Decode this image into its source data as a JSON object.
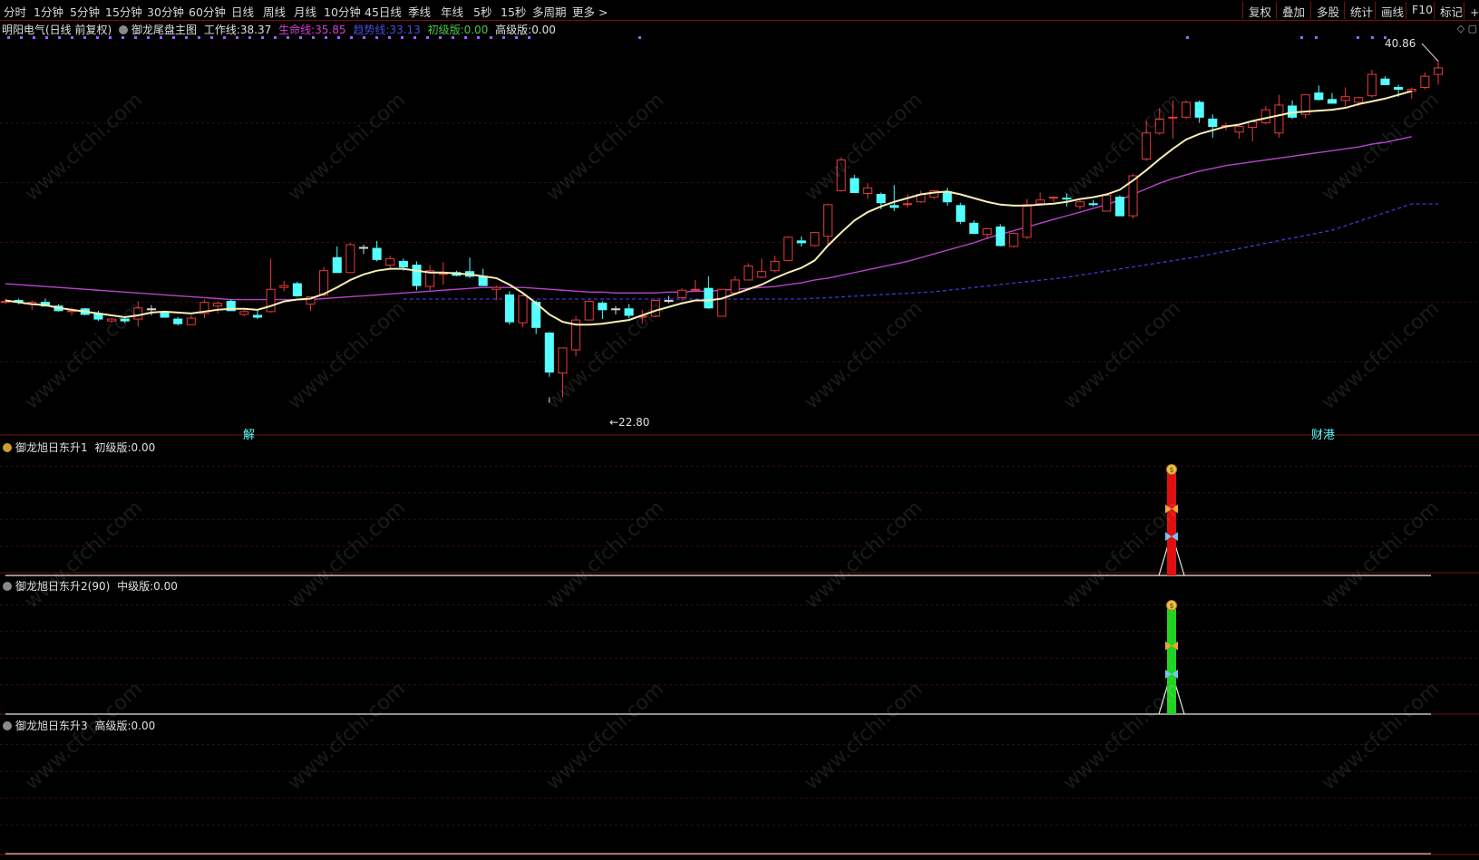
{
  "toolbar": {
    "left": [
      "分时",
      "1分钟",
      "5分钟",
      "15分钟",
      "30分钟",
      "60分钟",
      "日线",
      "周线",
      "月线",
      "10分钟",
      "45日线",
      "季线",
      "年线",
      "5秒",
      "15秒",
      "多周期",
      "更多 >"
    ],
    "right": [
      "复权",
      "叠加",
      "多股",
      "统计",
      "画线",
      "F10",
      "标记",
      "+自"
    ]
  },
  "main_header": {
    "stock": "明阳电气(日线 前复权)",
    "indicator": "御龙尾盘主图",
    "work_line_label": "工作线:",
    "work_line_value": "38.37",
    "life_line_label": "生命线:",
    "life_line_value": "35.85",
    "trend_line_label": "趋势线:",
    "trend_line_value": "33.13",
    "basic_label": "初级版:",
    "basic_value": "0.00",
    "advanced_label": "高级版:",
    "advanced_value": "0.00"
  },
  "annotations": {
    "high_label": "40.86",
    "low_label": "←22.80",
    "jie_label": "解",
    "caigang_label": "财港"
  },
  "panel1": {
    "title": "御龙旭日东升1",
    "label": "初级版:",
    "value": "0.00"
  },
  "panel2": {
    "title": "御龙旭日东升2(90)",
    "label": "中级版:",
    "value": "0.00"
  },
  "panel3": {
    "title": "御龙旭日东升3",
    "label": "高级版:",
    "value": "0.00"
  },
  "watermark": "www.cfchi.com",
  "colors": {
    "up": "#e83b3b",
    "down": "#54ffff",
    "flat": "#d8d8d8",
    "work_line": "#f7efb2",
    "life_line": "#b445c8",
    "trend_line": "#3b3bd6",
    "panel_border": "#7a1010",
    "signal_red": "#e01010",
    "signal_green": "#22d322"
  },
  "chart_data": {
    "type": "candlestick",
    "ylim": [
      21.5,
      42.2
    ],
    "candles": [
      {
        "o": 27.9,
        "h": 28.1,
        "l": 27.8,
        "c": 27.95
      },
      {
        "o": 28.0,
        "h": 28.1,
        "l": 27.8,
        "c": 27.9
      },
      {
        "o": 27.8,
        "h": 28.0,
        "l": 27.5,
        "c": 27.9
      },
      {
        "o": 27.9,
        "h": 28.1,
        "l": 27.7,
        "c": 27.7
      },
      {
        "o": 27.7,
        "h": 27.8,
        "l": 27.4,
        "c": 27.45
      },
      {
        "o": 27.4,
        "h": 27.6,
        "l": 27.2,
        "c": 27.45
      },
      {
        "o": 27.55,
        "h": 27.6,
        "l": 27.2,
        "c": 27.25
      },
      {
        "o": 27.3,
        "h": 27.45,
        "l": 26.9,
        "c": 27.0
      },
      {
        "o": 26.9,
        "h": 27.05,
        "l": 26.8,
        "c": 27.0
      },
      {
        "o": 27.0,
        "h": 27.1,
        "l": 26.8,
        "c": 26.9
      },
      {
        "o": 27.0,
        "h": 27.95,
        "l": 26.6,
        "c": 27.6
      },
      {
        "o": 27.55,
        "h": 27.75,
        "l": 27.2,
        "c": 27.55
      },
      {
        "o": 27.35,
        "h": 27.4,
        "l": 27.1,
        "c": 27.1
      },
      {
        "o": 27.0,
        "h": 27.1,
        "l": 26.65,
        "c": 26.75
      },
      {
        "o": 26.7,
        "h": 27.2,
        "l": 26.7,
        "c": 27.05
      },
      {
        "o": 27.3,
        "h": 28.05,
        "l": 27.05,
        "c": 27.9
      },
      {
        "o": 27.7,
        "h": 27.95,
        "l": 27.3,
        "c": 27.85
      },
      {
        "o": 27.95,
        "h": 28.05,
        "l": 27.45,
        "c": 27.45
      },
      {
        "o": 27.25,
        "h": 27.5,
        "l": 27.15,
        "c": 27.4
      },
      {
        "o": 27.2,
        "h": 27.45,
        "l": 27.0,
        "c": 27.1
      },
      {
        "o": 27.4,
        "h": 30.25,
        "l": 27.35,
        "c": 28.6
      },
      {
        "o": 28.7,
        "h": 29.05,
        "l": 28.5,
        "c": 28.8
      },
      {
        "o": 28.9,
        "h": 29.0,
        "l": 28.2,
        "c": 28.25
      },
      {
        "o": 27.8,
        "h": 28.2,
        "l": 27.45,
        "c": 28.2
      },
      {
        "o": 28.3,
        "h": 29.8,
        "l": 28.2,
        "c": 29.6
      },
      {
        "o": 30.3,
        "h": 30.9,
        "l": 29.9,
        "c": 29.5
      },
      {
        "o": 29.5,
        "h": 31.1,
        "l": 29.5,
        "c": 31.0
      },
      {
        "o": 30.85,
        "h": 31.0,
        "l": 30.5,
        "c": 30.85
      },
      {
        "o": 30.8,
        "h": 31.2,
        "l": 30.1,
        "c": 30.2
      },
      {
        "o": 29.9,
        "h": 30.4,
        "l": 29.7,
        "c": 30.25
      },
      {
        "o": 30.1,
        "h": 30.25,
        "l": 29.6,
        "c": 29.8
      },
      {
        "o": 29.9,
        "h": 30.1,
        "l": 28.55,
        "c": 28.8
      },
      {
        "o": 28.75,
        "h": 29.9,
        "l": 28.55,
        "c": 29.6
      },
      {
        "o": 29.4,
        "h": 30.05,
        "l": 28.85,
        "c": 29.45
      },
      {
        "o": 29.5,
        "h": 29.6,
        "l": 29.3,
        "c": 29.35
      },
      {
        "o": 29.55,
        "h": 30.3,
        "l": 29.2,
        "c": 29.3
      },
      {
        "o": 29.3,
        "h": 29.7,
        "l": 28.8,
        "c": 28.8
      },
      {
        "o": 28.6,
        "h": 28.8,
        "l": 28.0,
        "c": 28.7
      },
      {
        "o": 28.3,
        "h": 28.5,
        "l": 26.7,
        "c": 26.85
      },
      {
        "o": 26.8,
        "h": 28.4,
        "l": 26.55,
        "c": 28.25
      },
      {
        "o": 27.9,
        "h": 28.0,
        "l": 26.2,
        "c": 26.55
      },
      {
        "o": 26.25,
        "h": 26.3,
        "l": 23.9,
        "c": 24.15
      },
      {
        "o": 24.1,
        "h": 25.4,
        "l": 22.8,
        "c": 25.45
      },
      {
        "o": 25.35,
        "h": 27.15,
        "l": 25.0,
        "c": 26.95
      },
      {
        "o": 26.95,
        "h": 28.0,
        "l": 26.95,
        "c": 27.95
      },
      {
        "o": 27.85,
        "h": 27.95,
        "l": 27.0,
        "c": 27.5
      },
      {
        "o": 27.55,
        "h": 27.7,
        "l": 27.25,
        "c": 27.55
      },
      {
        "o": 27.55,
        "h": 27.8,
        "l": 27.05,
        "c": 27.2
      },
      {
        "o": 27.1,
        "h": 27.5,
        "l": 26.75,
        "c": 27.15
      },
      {
        "o": 27.15,
        "h": 28.05,
        "l": 27.1,
        "c": 28.0
      },
      {
        "o": 28.0,
        "h": 28.25,
        "l": 27.85,
        "c": 28.0
      },
      {
        "o": 28.15,
        "h": 28.65,
        "l": 28.0,
        "c": 28.55
      },
      {
        "o": 28.55,
        "h": 29.1,
        "l": 28.5,
        "c": 28.6
      },
      {
        "o": 28.65,
        "h": 29.3,
        "l": 27.55,
        "c": 27.6
      },
      {
        "o": 27.15,
        "h": 28.6,
        "l": 27.15,
        "c": 28.6
      },
      {
        "o": 28.4,
        "h": 29.3,
        "l": 28.4,
        "c": 29.1
      },
      {
        "o": 29.1,
        "h": 30.0,
        "l": 29.1,
        "c": 29.85
      },
      {
        "o": 29.25,
        "h": 30.25,
        "l": 29.2,
        "c": 29.55
      },
      {
        "o": 29.6,
        "h": 30.4,
        "l": 29.5,
        "c": 30.1
      },
      {
        "o": 30.15,
        "h": 31.45,
        "l": 30.1,
        "c": 31.4
      },
      {
        "o": 31.2,
        "h": 31.45,
        "l": 30.9,
        "c": 31.1
      },
      {
        "o": 30.95,
        "h": 31.65,
        "l": 30.9,
        "c": 31.65
      },
      {
        "o": 31.45,
        "h": 33.2,
        "l": 31.0,
        "c": 33.15
      },
      {
        "o": 33.9,
        "h": 35.7,
        "l": 33.85,
        "c": 35.55
      },
      {
        "o": 34.55,
        "h": 34.75,
        "l": 33.8,
        "c": 33.8
      },
      {
        "o": 33.75,
        "h": 34.3,
        "l": 33.45,
        "c": 34.05
      },
      {
        "o": 33.7,
        "h": 33.8,
        "l": 32.9,
        "c": 33.25
      },
      {
        "o": 33.1,
        "h": 34.2,
        "l": 32.8,
        "c": 33.0
      },
      {
        "o": 33.15,
        "h": 33.7,
        "l": 33.0,
        "c": 33.2
      },
      {
        "o": 33.3,
        "h": 33.9,
        "l": 33.25,
        "c": 33.7
      },
      {
        "o": 33.55,
        "h": 33.9,
        "l": 33.45,
        "c": 33.9
      },
      {
        "o": 33.85,
        "h": 34.05,
        "l": 33.1,
        "c": 33.3
      },
      {
        "o": 33.1,
        "h": 33.25,
        "l": 32.1,
        "c": 32.25
      },
      {
        "o": 32.15,
        "h": 32.3,
        "l": 31.6,
        "c": 31.6
      },
      {
        "o": 31.55,
        "h": 31.8,
        "l": 31.3,
        "c": 31.85
      },
      {
        "o": 31.95,
        "h": 32.1,
        "l": 30.9,
        "c": 30.95
      },
      {
        "o": 30.9,
        "h": 31.65,
        "l": 30.85,
        "c": 31.6
      },
      {
        "o": 31.4,
        "h": 33.45,
        "l": 31.3,
        "c": 33.15
      },
      {
        "o": 33.2,
        "h": 33.8,
        "l": 33.1,
        "c": 33.4
      },
      {
        "o": 33.5,
        "h": 33.6,
        "l": 33.3,
        "c": 33.55
      },
      {
        "o": 33.5,
        "h": 33.75,
        "l": 33.05,
        "c": 33.45
      },
      {
        "o": 33.05,
        "h": 33.4,
        "l": 32.9,
        "c": 33.3
      },
      {
        "o": 33.2,
        "h": 33.4,
        "l": 33.05,
        "c": 33.15
      },
      {
        "o": 32.8,
        "h": 33.65,
        "l": 32.8,
        "c": 33.65
      },
      {
        "o": 33.55,
        "h": 33.65,
        "l": 32.55,
        "c": 32.55
      },
      {
        "o": 32.55,
        "h": 34.8,
        "l": 32.4,
        "c": 34.7
      },
      {
        "o": 35.6,
        "h": 37.65,
        "l": 35.5,
        "c": 37.0
      },
      {
        "o": 37.0,
        "h": 38.35,
        "l": 36.9,
        "c": 37.75
      },
      {
        "o": 37.8,
        "h": 38.75,
        "l": 36.7,
        "c": 37.85
      },
      {
        "o": 37.85,
        "h": 38.75,
        "l": 37.75,
        "c": 38.65
      },
      {
        "o": 38.65,
        "h": 38.75,
        "l": 37.55,
        "c": 37.85
      },
      {
        "o": 37.75,
        "h": 38.0,
        "l": 36.75,
        "c": 37.35
      },
      {
        "o": 37.35,
        "h": 37.55,
        "l": 37.15,
        "c": 37.4
      },
      {
        "o": 37.05,
        "h": 37.35,
        "l": 36.7,
        "c": 37.35
      },
      {
        "o": 37.3,
        "h": 37.6,
        "l": 36.55,
        "c": 37.6
      },
      {
        "o": 37.55,
        "h": 38.45,
        "l": 37.45,
        "c": 38.25
      },
      {
        "o": 37.0,
        "h": 39.05,
        "l": 36.75,
        "c": 38.5
      },
      {
        "o": 38.45,
        "h": 38.75,
        "l": 37.75,
        "c": 37.85
      },
      {
        "o": 38.0,
        "h": 38.85,
        "l": 37.8,
        "c": 39.05
      },
      {
        "o": 39.15,
        "h": 39.55,
        "l": 38.75,
        "c": 38.8
      },
      {
        "o": 38.8,
        "h": 39.15,
        "l": 38.6,
        "c": 38.6
      },
      {
        "o": 38.75,
        "h": 39.45,
        "l": 38.45,
        "c": 38.95
      },
      {
        "o": 38.65,
        "h": 38.95,
        "l": 38.45,
        "c": 38.9
      },
      {
        "o": 39.0,
        "h": 40.4,
        "l": 38.9,
        "c": 40.15
      },
      {
        "o": 39.9,
        "h": 40.05,
        "l": 39.6,
        "c": 39.6
      },
      {
        "o": 39.45,
        "h": 39.6,
        "l": 38.95,
        "c": 39.35
      },
      {
        "o": 39.25,
        "h": 39.45,
        "l": 38.85,
        "c": 39.35
      },
      {
        "o": 39.45,
        "h": 40.25,
        "l": 39.35,
        "c": 40.05
      },
      {
        "o": 40.15,
        "h": 40.9,
        "l": 39.6,
        "c": 40.5
      }
    ],
    "work_line": [
      28.0,
      27.9,
      27.8,
      27.75,
      27.6,
      27.5,
      27.4,
      27.3,
      27.2,
      27.1,
      27.2,
      27.35,
      27.4,
      27.35,
      27.3,
      27.4,
      27.5,
      27.55,
      27.55,
      27.5,
      27.7,
      27.95,
      28.05,
      28.1,
      28.35,
      28.7,
      29.1,
      29.4,
      29.6,
      29.7,
      29.7,
      29.6,
      29.5,
      29.5,
      29.45,
      29.4,
      29.3,
      29.2,
      28.85,
      28.4,
      27.85,
      27.25,
      26.85,
      26.7,
      26.7,
      26.75,
      26.85,
      26.95,
      27.2,
      27.45,
      27.65,
      27.85,
      28.0,
      28.0,
      28.1,
      28.35,
      28.6,
      28.85,
      29.2,
      29.5,
      29.75,
      30.15,
      30.95,
      31.65,
      32.3,
      32.75,
      33.05,
      33.3,
      33.5,
      33.7,
      33.8,
      33.85,
      33.7,
      33.5,
      33.3,
      33.15,
      33.1,
      33.1,
      33.15,
      33.2,
      33.3,
      33.45,
      33.55,
      33.7,
      33.95,
      34.45,
      35.0,
      35.6,
      36.15,
      36.65,
      36.95,
      37.15,
      37.35,
      37.45,
      37.65,
      37.8,
      37.95,
      38.1,
      38.15,
      38.2,
      38.25,
      38.35,
      38.55,
      38.7,
      38.85,
      39.05,
      39.25
    ],
    "life_line": [
      28.9,
      28.85,
      28.8,
      28.75,
      28.7,
      28.65,
      28.6,
      28.55,
      28.5,
      28.45,
      28.4,
      28.35,
      28.3,
      28.25,
      28.2,
      28.15,
      28.1,
      28.05,
      28.05,
      28.05,
      28.05,
      28.05,
      28.05,
      28.05,
      28.1,
      28.15,
      28.2,
      28.25,
      28.3,
      28.35,
      28.4,
      28.45,
      28.5,
      28.55,
      28.6,
      28.65,
      28.7,
      28.7,
      28.7,
      28.7,
      28.65,
      28.6,
      28.55,
      28.5,
      28.45,
      28.45,
      28.4,
      28.4,
      28.4,
      28.4,
      28.45,
      28.45,
      28.5,
      28.5,
      28.55,
      28.6,
      28.65,
      28.7,
      28.75,
      28.85,
      28.95,
      29.1,
      29.2,
      29.35,
      29.5,
      29.65,
      29.8,
      29.95,
      30.1,
      30.3,
      30.5,
      30.7,
      30.9,
      31.1,
      31.35,
      31.55,
      31.75,
      31.95,
      32.15,
      32.35,
      32.55,
      32.75,
      32.95,
      33.15,
      33.4,
      33.7,
      34.0,
      34.3,
      34.55,
      34.75,
      34.95,
      35.1,
      35.25,
      35.35,
      35.45,
      35.55,
      35.65,
      35.75,
      35.85,
      35.95,
      36.05,
      36.15,
      36.25,
      36.4,
      36.5,
      36.65,
      36.8
    ]
  }
}
